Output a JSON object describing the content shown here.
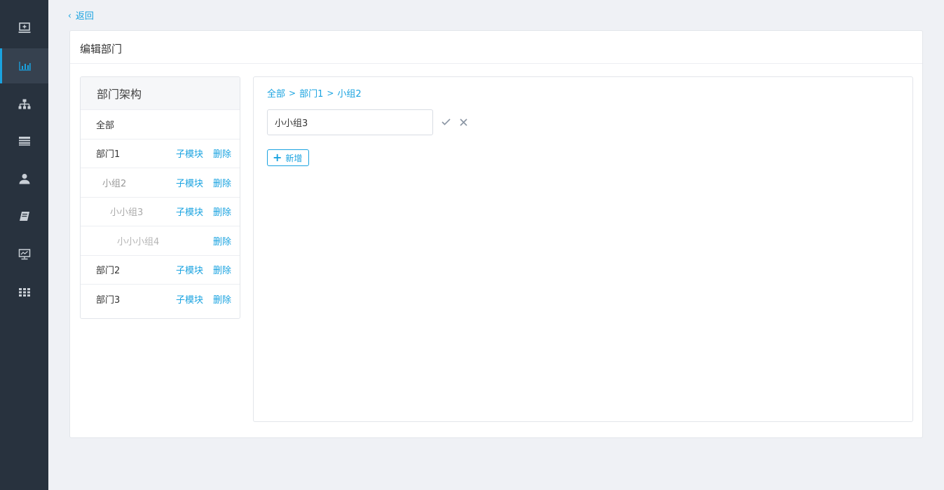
{
  "sidebar": {
    "items": [
      {
        "icon": "screen-plus-icon",
        "active": false
      },
      {
        "icon": "bar-chart-icon",
        "active": true
      },
      {
        "icon": "org-tree-icon",
        "active": false
      },
      {
        "icon": "list-icon",
        "active": false
      },
      {
        "icon": "user-icon",
        "active": false
      },
      {
        "icon": "book-icon",
        "active": false
      },
      {
        "icon": "monitor-chart-icon",
        "active": false
      },
      {
        "icon": "apps-grid-icon",
        "active": false
      }
    ]
  },
  "back": {
    "label": "返回"
  },
  "panel": {
    "title": "编辑部门"
  },
  "tree": {
    "header": "部门架构",
    "rows": [
      {
        "name": "全部",
        "level": 0,
        "sub_label": "",
        "delete_label": ""
      },
      {
        "name": "部门1",
        "level": 0,
        "sub_label": "子模块",
        "delete_label": "删除"
      },
      {
        "name": "小组2",
        "level": 1,
        "sub_label": "子模块",
        "delete_label": "删除"
      },
      {
        "name": "小小组3",
        "level": 2,
        "sub_label": "子模块",
        "delete_label": "删除"
      },
      {
        "name": "小小小组4",
        "level": 3,
        "sub_label": "",
        "delete_label": "删除"
      },
      {
        "name": "部门2",
        "level": 0,
        "sub_label": "子模块",
        "delete_label": "删除"
      },
      {
        "name": "部门3",
        "level": 0,
        "sub_label": "子模块",
        "delete_label": "删除"
      }
    ]
  },
  "edit": {
    "breadcrumb": [
      "全部",
      "部门1",
      "小组2"
    ],
    "breadcrumb_sep": ">",
    "input_value": "小小组3",
    "add_label": "新增",
    "add_symbol": "+"
  },
  "colors": {
    "accent": "#1aa3e0",
    "sidebar_bg": "#28323e",
    "page_bg": "#eff1f5"
  }
}
